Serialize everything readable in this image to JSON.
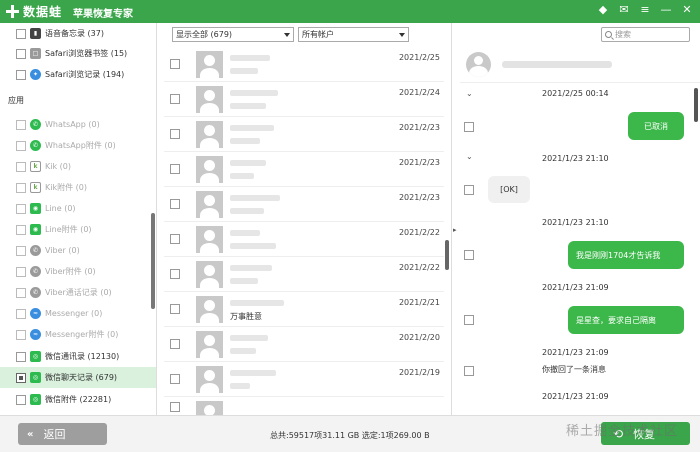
{
  "app": {
    "logo_text": "数据蛙",
    "subtitle": "苹果恢复专家"
  },
  "window_controls": [
    "◆",
    "✉",
    "≡",
    "—",
    "✕"
  ],
  "sidebar": {
    "section_label": "应用",
    "items": [
      {
        "label": "语音备忘录 (37)",
        "icon": "dark",
        "glyph": "▮",
        "enabled": true,
        "selected": false
      },
      {
        "label": "Safari浏览器书签 (15)",
        "icon": "grey",
        "glyph": "□",
        "enabled": true,
        "selected": false
      },
      {
        "label": "Safari浏览记录 (194)",
        "icon": "blue",
        "glyph": "✦",
        "enabled": true,
        "selected": false
      },
      {
        "label": "WhatsApp (0)",
        "icon": "green",
        "glyph": "✆",
        "enabled": false,
        "selected": false
      },
      {
        "label": "WhatsApp附件 (0)",
        "icon": "green",
        "glyph": "✆",
        "enabled": false,
        "selected": false
      },
      {
        "label": "Kik (0)",
        "icon": "kik",
        "glyph": "k",
        "enabled": false,
        "selected": false
      },
      {
        "label": "Kik附件 (0)",
        "icon": "kik",
        "glyph": "k",
        "enabled": false,
        "selected": false
      },
      {
        "label": "Line (0)",
        "icon": "green",
        "glyph": "◉",
        "enabled": false,
        "selected": false
      },
      {
        "label": "Line附件 (0)",
        "icon": "green",
        "glyph": "◉",
        "enabled": false,
        "selected": false
      },
      {
        "label": "Viber (0)",
        "icon": "grey",
        "glyph": "✆",
        "enabled": false,
        "selected": false
      },
      {
        "label": "Viber附件 (0)",
        "icon": "grey",
        "glyph": "✆",
        "enabled": false,
        "selected": false
      },
      {
        "label": "Viber通话记录 (0)",
        "icon": "grey",
        "glyph": "✆",
        "enabled": false,
        "selected": false
      },
      {
        "label": "Messenger (0)",
        "icon": "blue",
        "glyph": "≈",
        "enabled": false,
        "selected": false
      },
      {
        "label": "Messenger附件 (0)",
        "icon": "blue",
        "glyph": "≈",
        "enabled": false,
        "selected": false
      },
      {
        "label": "微信通讯录 (12130)",
        "icon": "green",
        "glyph": "◎",
        "enabled": true,
        "selected": false
      },
      {
        "label": "微信聊天记录 (679)",
        "icon": "green",
        "glyph": "◎",
        "enabled": true,
        "selected": true
      },
      {
        "label": "微信附件 (22281)",
        "icon": "green",
        "glyph": "◎",
        "enabled": true,
        "selected": false
      }
    ]
  },
  "filters": {
    "show_all": "显示全部 (679)",
    "accounts": "所有帐户"
  },
  "search": {
    "placeholder": "搜索"
  },
  "messages": [
    {
      "date": "2021/2/25",
      "preview": ""
    },
    {
      "date": "2021/2/24",
      "preview": ""
    },
    {
      "date": "2021/2/23",
      "preview": ""
    },
    {
      "date": "2021/2/23",
      "preview": ""
    },
    {
      "date": "2021/2/23",
      "preview": ""
    },
    {
      "date": "2021/2/22",
      "preview": ""
    },
    {
      "date": "2021/2/22",
      "preview": ""
    },
    {
      "date": "2021/2/21",
      "preview": "万事胜意"
    },
    {
      "date": "2021/2/20",
      "preview": ""
    },
    {
      "date": "2021/2/19",
      "preview": ""
    },
    {
      "date": "",
      "preview": ""
    }
  ],
  "chat": {
    "timestamps": [
      "2021/2/25 00:14",
      "2021/1/23 21:10",
      "2021/1/23 21:10",
      "2021/1/23 21:09",
      "2021/1/23 21:09",
      "2021/1/23 21:09"
    ],
    "bubble_cancelled": "已取消",
    "bubble_ok": "[OK]",
    "bubble_1704": "我是刚刚1704才告诉我",
    "bubble_quarantine": "是星查，要求自己隔离",
    "recall_notice": "你撤回了一条消息"
  },
  "footer": {
    "back_arrows": "«",
    "back_label": "返回",
    "status": "总共:59517项31.11 GB 选定:1项269.00 B",
    "recover_label": "恢复"
  },
  "watermark": "稀土掘金技术社区",
  "colors": {
    "brand_green": "#3aa54a",
    "selected_bg": "#d9f1dd"
  }
}
